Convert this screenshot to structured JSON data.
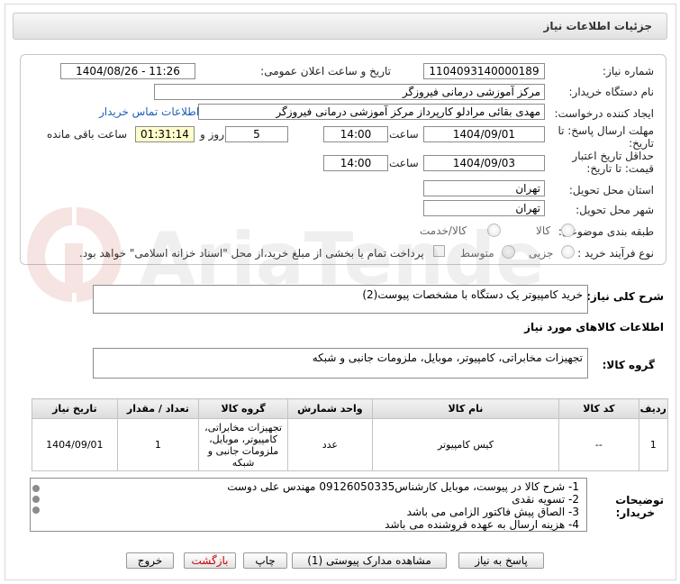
{
  "header": {
    "title": "جزئیات اطلاعات نیاز"
  },
  "form": {
    "need_number_label": "شماره نیاز:",
    "need_number": "1104093140000189",
    "announce_label": "تاریخ و ساعت اعلان عمومی:",
    "announce_value": "1404/08/26 - 11:26",
    "buyer_org_label": "نام دستگاه خریدار:",
    "buyer_org": "مرکز آموزشی درمانی فیروزگر",
    "creator_label": "ایجاد کننده درخواست:",
    "creator": "مهدی بقائی مرادلو کارپرداز مرکز آموزشی درمانی فیروزگر",
    "contact_link": "اطلاعات تماس خریدار",
    "deadline_label_1": "مهلت ارسال پاسخ: تا",
    "deadline_label_2": "تاریخ:",
    "deadline_date": "1404/09/01",
    "time_label": "ساعت",
    "deadline_time": "14:00",
    "days": "5",
    "days_label": "روز و",
    "remaining": "01:31:14",
    "remaining_label": "ساعت باقی مانده",
    "validity_label_1": "حداقل تاریخ اعتبار",
    "validity_label_2": "قیمت: تا تاریخ:",
    "validity_date": "1404/09/03",
    "validity_time": "14:00",
    "province_label": "استان محل تحویل:",
    "province": "تهران",
    "city_label": "شهر محل تحویل:",
    "city": "تهران",
    "category_label": "طبقه بندی موضوعی:",
    "category_goods": "کالا",
    "category_goods_service": "کالا/خدمت",
    "process_label": "نوع فرآیند خرید :",
    "process_minor": "جزیی",
    "process_medium": "متوسط",
    "payment_note": "پرداخت تمام یا بخشی از مبلغ خرید،از محل \"اسناد خزانه اسلامی\" خواهد بود."
  },
  "summary": {
    "label": "شرح کلی نیاز:",
    "value": "خرید کامپیوتر یک دستگاه با مشخصات پیوست(2)"
  },
  "goods_info": {
    "title": "اطلاعات کالاهای مورد نیاز",
    "group_label": "گروه کالا:",
    "group_value": "تجهیزات مخابراتی، کامپیوتر، موبایل، ملزومات جانبی و شبکه"
  },
  "table": {
    "headers": [
      "ردیف",
      "کد کالا",
      "نام کالا",
      "واحد شمارش",
      "گروه کالا",
      "تعداد / مقدار",
      "تاریخ نیاز"
    ],
    "rows": [
      {
        "row": "1",
        "code": "--",
        "name": "کیس کامپیوتر",
        "unit": "عدد",
        "group": "تجهیزات مخابراتی، کامپیوتر، موبایل، ملزومات جانبی و شبکه",
        "qty": "1",
        "date": "1404/09/01"
      }
    ]
  },
  "buyer_notes": {
    "label_1": "توضیحات",
    "label_2": "خریدار:",
    "lines": [
      "1- شرح کالا در پیوست، موبایل کارشناس09126050335 مهندس علی دوست",
      "2- تسویه نقدی",
      "3- الصاق پیش فاکتور الزامی می باشد",
      "4- هزینه ارسال به عهده فروشنده می باشد"
    ]
  },
  "buttons": {
    "reply": "پاسخ به نیاز",
    "attachments": "مشاهده مدارک پیوستی (1)",
    "print": "چاپ",
    "back": "بازگشت",
    "exit": "خروج"
  },
  "watermark_text": "AriaTender.neT"
}
